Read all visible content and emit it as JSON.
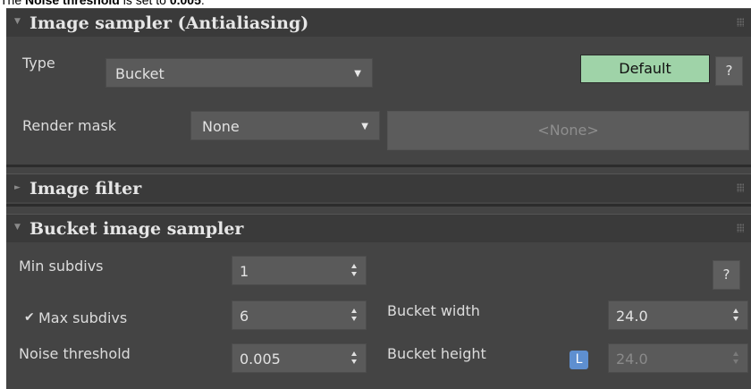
{
  "caption": {
    "prefix": "The ",
    "bold_label": "Noise threshold",
    "middle": " is set to ",
    "bold_value": "0.005",
    "suffix": "."
  },
  "rollouts": {
    "image_sampler": {
      "arrow": "▼",
      "title": "Image sampler (Antialiasing)",
      "type_label": "Type",
      "type_value": "Bucket",
      "default_button": "Default",
      "help": "?",
      "render_mask_label": "Render mask",
      "render_mask_value": "None",
      "render_mask_field": "<None>"
    },
    "image_filter": {
      "arrow": "►",
      "title": "Image filter"
    },
    "bucket_sampler": {
      "arrow": "▼",
      "title": "Bucket image sampler",
      "help": "?",
      "min_subdivs_label": "Min subdivs",
      "min_subdivs_value": "1",
      "max_subdivs_label": "Max subdivs",
      "max_subdivs_checked": true,
      "max_subdivs_value": "6",
      "noise_threshold_label": "Noise threshold",
      "noise_threshold_value": "0.005",
      "bucket_width_label": "Bucket width",
      "bucket_width_value": "24.0",
      "bucket_height_label": "Bucket height",
      "lock_label": "L",
      "bucket_height_value": "24.0"
    }
  },
  "colors": {
    "panel_bg": "#444444",
    "default_button": "#9fd3a8",
    "lock_button": "#5e8fd0"
  }
}
